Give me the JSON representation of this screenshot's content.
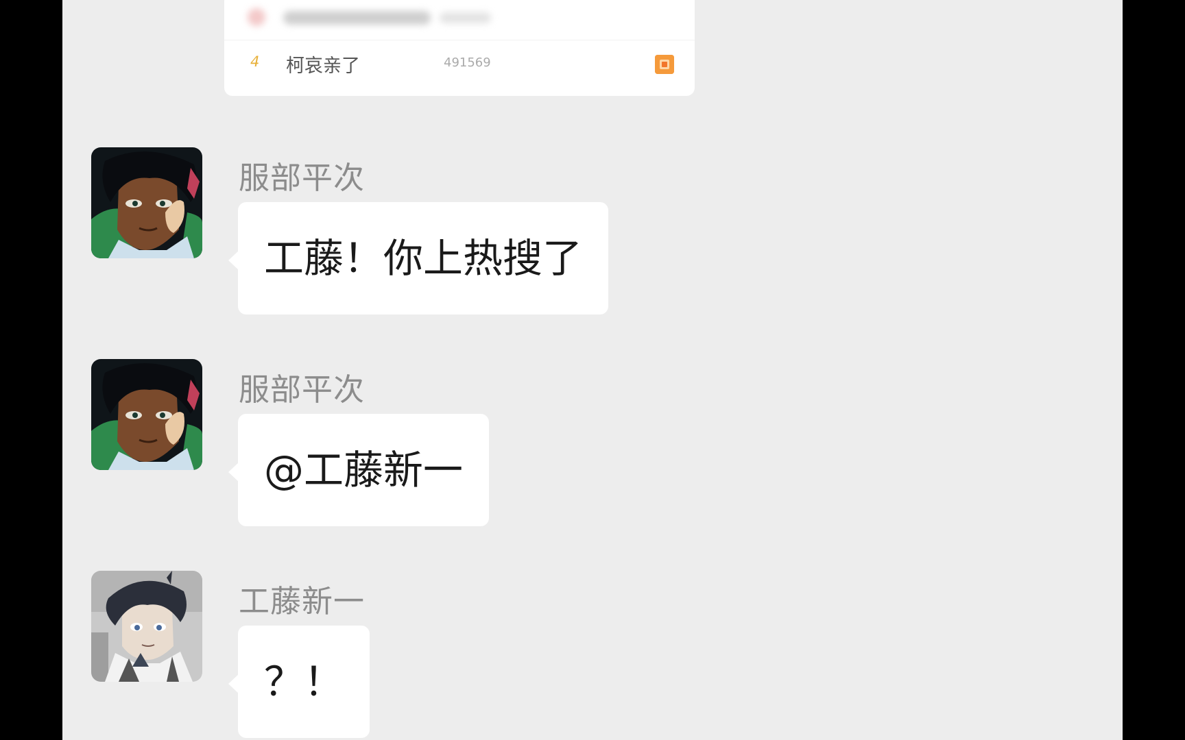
{
  "colors": {
    "chat_background": "#ededed",
    "bubble": "#ffffff",
    "sender_name": "#8c8c8c",
    "rank_number": "#e8b13a",
    "hot_badge": "#f59a3b"
  },
  "shared_card": {
    "rank": "4",
    "title": "柯哀亲了",
    "count": "491569",
    "badge_icon": "hot-badge-icon"
  },
  "messages": [
    {
      "sender": "服部平次",
      "text": "工藤！你上热搜了",
      "avatar": "hattori-avatar"
    },
    {
      "sender": "服部平次",
      "text": "@工藤新一",
      "avatar": "hattori-avatar"
    },
    {
      "sender": "工藤新一",
      "text": "？！",
      "avatar": "kudo-avatar"
    }
  ]
}
